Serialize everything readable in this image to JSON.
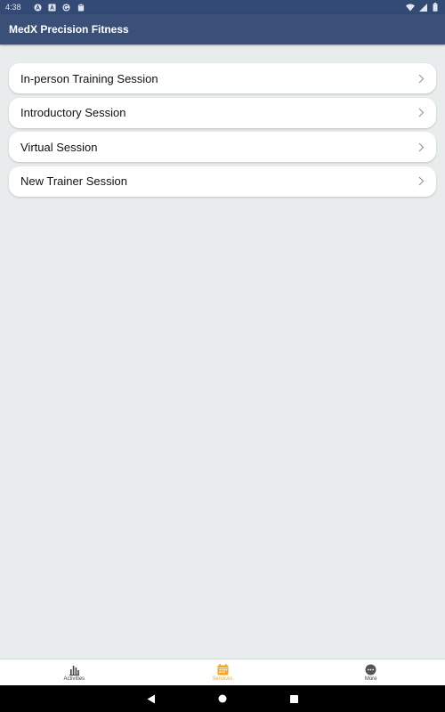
{
  "status_bar": {
    "time": "4:38",
    "icons": [
      "a-circle-icon",
      "a-square-icon",
      "g-circle-icon",
      "clipboard-icon"
    ],
    "right_icons": [
      "wifi-icon",
      "signal-icon",
      "battery-icon"
    ]
  },
  "app": {
    "title": "MedX Precision Fitness",
    "header_color": "#3a5079",
    "accent_color": "#f5a623"
  },
  "services": [
    {
      "label": "In-person Training Session",
      "icon": "chevron-right-icon"
    },
    {
      "label": "Introductory Session",
      "icon": "chevron-right-icon"
    },
    {
      "label": "Virtual Session",
      "icon": "chevron-right-icon"
    },
    {
      "label": "New Trainer Session",
      "icon": "chevron-right-icon"
    }
  ],
  "tabs": [
    {
      "label": "Activities",
      "icon": "bar-chart-icon",
      "active": false
    },
    {
      "label": "Services",
      "icon": "calendar-icon",
      "active": true
    },
    {
      "label": "More",
      "icon": "more-dots-icon",
      "active": false
    }
  ],
  "nav": {
    "buttons": [
      "back-icon",
      "home-icon",
      "recents-icon"
    ]
  }
}
